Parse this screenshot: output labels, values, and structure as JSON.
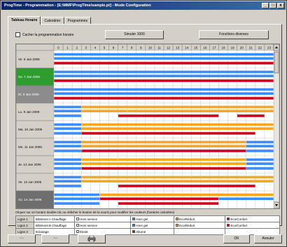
{
  "window": {
    "title": "ProgTime - Programmation - [E:\\MMF\\ProgTime\\sample.pt] - Mode Configuration",
    "minimize": "_",
    "maximize": "□",
    "close": "x"
  },
  "tabs": [
    {
      "label": "Tableau Horaire",
      "active": true
    },
    {
      "label": "Calendrier",
      "active": false
    },
    {
      "label": "Programmes",
      "active": false
    }
  ],
  "toolbar": {
    "checkbox_label": "Cacher la programmation horaire",
    "simulate_button": "Simuler 1000",
    "special_button": "Fonctions diverses"
  },
  "grid": {
    "hours": [
      "0",
      "1",
      "2",
      "3",
      "4",
      "5",
      "6",
      "7",
      "8",
      "9",
      "10",
      "11",
      "12",
      "13",
      "14",
      "15",
      "16",
      "17",
      "18",
      "19",
      "20",
      "21",
      "22",
      "23"
    ],
    "days": [
      {
        "label": "Ve. 6 Jan 2006",
        "style": "normal",
        "lines": [
          [
            [
              0,
              24,
              "blue"
            ]
          ],
          [
            [
              0,
              24,
              "blue"
            ]
          ],
          [
            [
              0,
              24,
              "red"
            ]
          ]
        ]
      },
      {
        "label": "Sa. 7 Jan 2006",
        "style": "green",
        "lines": [
          [
            [
              0,
              24,
              "blue"
            ]
          ],
          [
            [
              0,
              24,
              "blue"
            ]
          ],
          [
            [
              0,
              24,
              "red"
            ]
          ]
        ]
      },
      {
        "label": "Di. 8 Jan 2006",
        "style": "gray",
        "lines": [
          [
            [
              0,
              24,
              "blue"
            ]
          ],
          [
            [
              0,
              24,
              "blue"
            ]
          ],
          [
            [
              0,
              24,
              "red"
            ]
          ]
        ]
      },
      {
        "label": "Lu. 9 Jan 2006",
        "style": "normal",
        "lines": [
          [
            [
              0,
              3,
              "blue"
            ],
            [
              3,
              24,
              "orange"
            ]
          ],
          [
            [
              0,
              3,
              "blue"
            ],
            [
              3,
              8,
              "orange"
            ],
            [
              8,
              24,
              "orange"
            ]
          ],
          [
            [
              0,
              3,
              "blue"
            ],
            [
              7,
              18,
              "red"
            ],
            [
              20,
              23,
              "red"
            ]
          ]
        ]
      },
      {
        "label": "Ma. 10 Jan 2006",
        "style": "normal",
        "lines": [
          [
            [
              0,
              3,
              "blue"
            ],
            [
              3,
              24,
              "orange"
            ]
          ],
          [
            [
              0,
              3,
              "blue"
            ],
            [
              3,
              24,
              "orange"
            ]
          ],
          [
            [
              0,
              3,
              "blue"
            ],
            [
              3,
              22,
              "red"
            ]
          ]
        ]
      },
      {
        "label": "Me. 11 Jan 2006",
        "style": "normal",
        "lines": [
          [
            [
              0,
              3,
              "blue"
            ],
            [
              3,
              21,
              "orange"
            ],
            [
              21,
              24,
              "blue"
            ]
          ],
          [
            [
              0,
              3,
              "blue"
            ],
            [
              3,
              21,
              "orange"
            ],
            [
              21,
              24,
              "blue"
            ]
          ],
          [
            [
              0,
              3,
              "blue"
            ],
            [
              3,
              21,
              "red"
            ],
            [
              21,
              24,
              "blue"
            ]
          ]
        ]
      },
      {
        "label": "Je. 12 Jan 2006",
        "style": "normal",
        "lines": [
          [
            [
              0,
              3,
              "blue"
            ],
            [
              3,
              7,
              "orange"
            ],
            [
              7,
              17,
              "orange"
            ],
            [
              17,
              21,
              "orange"
            ],
            [
              21,
              24,
              "blue"
            ]
          ],
          [
            [
              0,
              3,
              "blue"
            ],
            [
              3,
              21,
              "orange"
            ],
            [
              21,
              24,
              "blue"
            ]
          ],
          [
            [
              0,
              3,
              "blue"
            ],
            [
              3,
              21,
              "red"
            ],
            [
              21,
              24,
              "blue"
            ]
          ]
        ]
      },
      {
        "label": "Ve. 13 Jan 2006",
        "style": "normal",
        "lines": [
          [
            [
              0,
              3,
              "blue"
            ],
            [
              3,
              24,
              "orange"
            ]
          ],
          [
            [
              0,
              3,
              "blue"
            ],
            [
              3,
              24,
              "orange"
            ]
          ],
          [
            [
              0,
              3,
              "blue"
            ],
            [
              7,
              22,
              "red"
            ]
          ]
        ]
      },
      {
        "label": "Sa. 14 Jan 2006",
        "style": "selected",
        "lines": [
          [
            [
              0,
              5,
              "blue"
            ],
            [
              5,
              24,
              "orange"
            ]
          ],
          [
            [
              0,
              5,
              "blue"
            ],
            [
              5,
              18,
              "red"
            ],
            [
              18,
              24,
              "blue"
            ]
          ],
          [
            [
              0,
              5,
              "blue"
            ],
            [
              7,
              18,
              "red"
            ]
          ]
        ]
      }
    ]
  },
  "legend": {
    "caption": "Cliquer sur un horaire double-clic ou relâcher le bouton de la souris pour modifier les couleurs (horaires calculées)",
    "rows": [
      {
        "header": "Ligne 1",
        "name": "Bâtiment A Chauffage",
        "cells": [
          {
            "color": "#ffffff",
            "label": "Hors service"
          },
          {
            "color": "#3c8cff",
            "label": "Hors gel"
          },
          {
            "color": "#f5a623",
            "label": "Eco/Réduit"
          },
          {
            "color": "#d0021b",
            "label": "Eco/Confort"
          }
        ]
      },
      {
        "header": "Ligne 2",
        "name": "Bâtiment B Chauffage",
        "cells": [
          {
            "color": "#ffffff",
            "label": "Hors service"
          },
          {
            "color": "#3c8cff",
            "label": "Hors gel"
          },
          {
            "color": "#f5a623",
            "label": "Eco/Réduit"
          },
          {
            "color": "#d0021b",
            "label": "Eco/Confort"
          }
        ]
      },
      {
        "header": "Ligne 3",
        "name": "Eclairage",
        "cells": [
          {
            "color": "#ffffff",
            "label": "Eteint"
          },
          {
            "color": "#d0021b",
            "label": "Allumé"
          },
          {
            "color": "",
            "label": ""
          },
          {
            "color": "",
            "label": ""
          }
        ]
      }
    ]
  },
  "footer": {
    "prev_label": "<<",
    "next_label": ">>",
    "print_icon": "printer-icon",
    "ok_label": "OK",
    "cancel_label": "Annuler"
  },
  "colors": {
    "blue": "#3c8cff",
    "orange": "#f5a623",
    "red": "#d0021b",
    "green": "#2e9c2e",
    "gray": "#8c8c8c",
    "selected": "#6e6e6e"
  }
}
